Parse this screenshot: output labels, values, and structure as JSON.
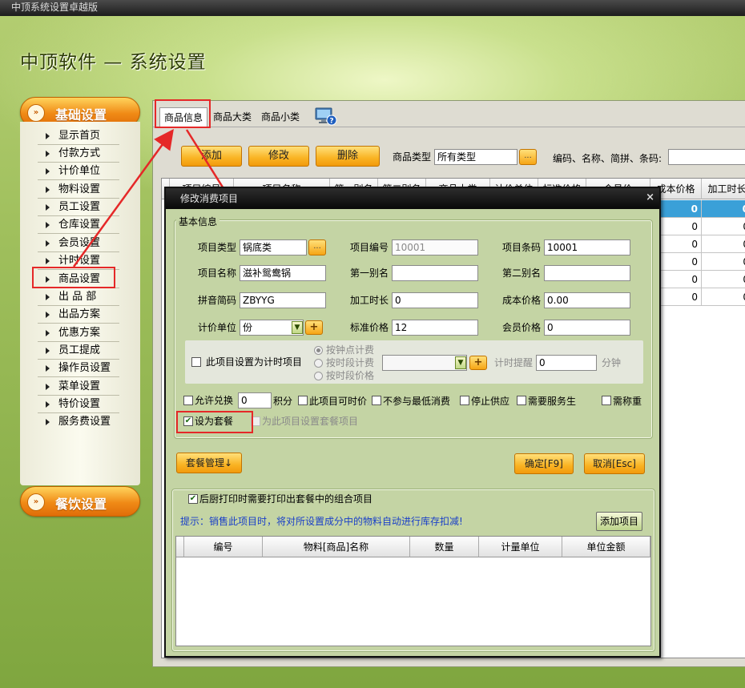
{
  "window_title": "中顶系统设置卓越版",
  "app_title": "中顶软件 — 系统设置",
  "nav": {
    "section1": "基础设置",
    "items": [
      "显示首页",
      "付款方式",
      "计价单位",
      "物料设置",
      "员工设置",
      "仓库设置",
      "会员设置",
      "计时设置",
      "商品设置",
      "出 品 部",
      "出品方案",
      "优惠方案",
      "员工提成",
      "操作员设置",
      "菜单设置",
      "特价设置",
      "服务费设置"
    ],
    "section2": "餐饮设置"
  },
  "tabs": [
    "商品信息",
    "商品大类",
    "商品小类"
  ],
  "toolbar": {
    "add": "添加",
    "edit": "修改",
    "delete": "删除",
    "type_label": "商品类型",
    "type_value": "所有类型",
    "dots": "...",
    "search_label": "编码、名称、简拼、条码:",
    "search_value": ""
  },
  "grid": {
    "headers": [
      "项目编号",
      "项目名称",
      "第一别名",
      "第二别名",
      "商品大类",
      "计价单位",
      "标准价格",
      "会员价",
      "成本价格",
      "加工时长"
    ],
    "col_cost": [
      "0",
      "0",
      "0",
      "0",
      "0",
      "0"
    ],
    "col_time": [
      "0",
      "0",
      "0",
      "0",
      "0",
      "0"
    ]
  },
  "dialog": {
    "title": "修改消费项目",
    "close": "×",
    "group_basic": "基本信息",
    "fields": {
      "type_label": "项目类型",
      "type_value": "锅底类",
      "code_label": "项目编号",
      "code_value": "10001",
      "barcode_label": "项目条码",
      "barcode_value": "10001",
      "name_label": "项目名称",
      "name_value": "滋补鸳鸯锅",
      "alias1_label": "第一别名",
      "alias1_value": "",
      "alias2_label": "第二别名",
      "alias2_value": "",
      "pinyin_label": "拼音简码",
      "pinyin_value": "ZBYYG",
      "proc_label": "加工时长",
      "proc_value": "0",
      "cost_label": "成本价格",
      "cost_value": "0.00",
      "unit_label": "计价单位",
      "unit_value": "份",
      "std_label": "标准价格",
      "std_value": "12",
      "member_label": "会员价格",
      "member_value": "0"
    },
    "timing": {
      "checkbox": "此项目设置为计时项目",
      "radio1": "按钟点计费",
      "radio2": "按时段计费",
      "radio3": "按时段价格",
      "remind_label": "计时提醒",
      "remind_value": "0",
      "minutes": "分钟"
    },
    "options": {
      "allow_exchange": "允许兑换",
      "exchange_value": "0",
      "points": "积分",
      "timed": "此项目可时价",
      "no_min": "不参与最低消费",
      "stop": "停止供应",
      "service": "需要服务生",
      "weigh": "需称重",
      "set_meal": "设为套餐",
      "set_meal_items": "为此项目设置套餐项目"
    },
    "buttons": {
      "set_manage": "套餐管理↓",
      "ok": "确定[F9]",
      "cancel": "取消[Esc]"
    },
    "combo": {
      "checkbox": "后厨打印时需要打印出套餐中的组合项目",
      "hint": "提示：销售此项目时，将对所设置成分中的物料自动进行库存扣减!",
      "add": "添加项目",
      "headers": [
        "编号",
        "物料[商品]名称",
        "数量",
        "计量单位",
        "单位金额"
      ]
    }
  }
}
